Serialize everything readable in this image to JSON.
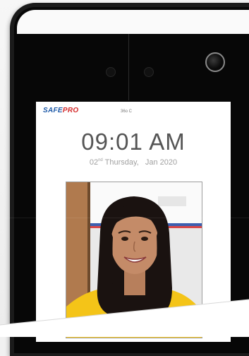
{
  "brand": {
    "safe": "SAFE",
    "pro": "PRO"
  },
  "status": {
    "temperature": "36o C"
  },
  "clock": {
    "time": "09:01 AM"
  },
  "date": {
    "day": "02",
    "suffix": "nd",
    "weekday": "Thursday,",
    "month_year": "Jan 2020"
  },
  "colors": {
    "brand_blue": "#1e5aa8",
    "brand_red": "#d42b2b",
    "device_frame": "#1b1b1b",
    "screen_bg": "#ffffff"
  },
  "icons": {
    "camera": "camera-lens-icon",
    "sensor": "sensor-dot-icon"
  }
}
